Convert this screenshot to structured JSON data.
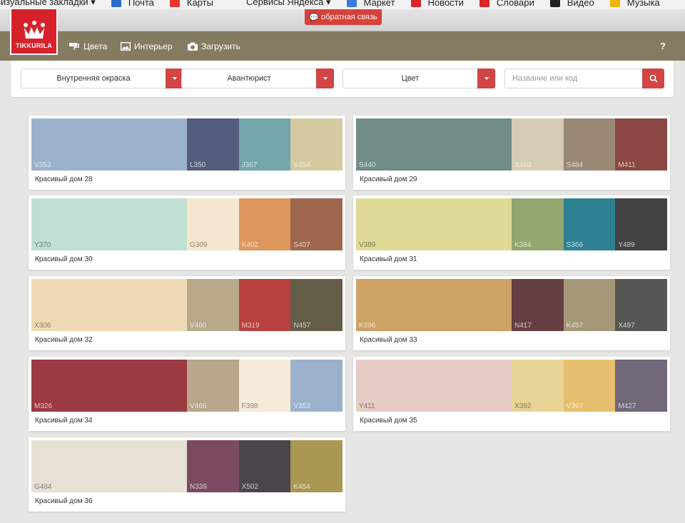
{
  "bookmarks": [
    {
      "label": "визуальные закладки ▾",
      "color": "#f2f2f2"
    },
    {
      "label": "Почта",
      "color": "#2a6ac9"
    },
    {
      "label": "Карты",
      "color": "#e8382e"
    },
    {
      "label": "Сервисы Яндекса ▾",
      "color": "#f2f2f2"
    },
    {
      "label": "Маркет",
      "color": "#3a7be0"
    },
    {
      "label": "Новости",
      "color": "#d9252a"
    },
    {
      "label": "Словари",
      "color": "#d9252a"
    },
    {
      "label": "Видео",
      "color": "#222222"
    },
    {
      "label": "Музыка",
      "color": "#f0b400"
    }
  ],
  "feedback_label": "обратная связь",
  "logo_text": "TIKKURILA",
  "nav": [
    {
      "label": "Цвета",
      "icon": "paint-roller-icon"
    },
    {
      "label": "Интерьер",
      "icon": "image-icon"
    },
    {
      "label": "Загрузить",
      "icon": "camera-icon"
    }
  ],
  "help_label": "?",
  "filters": {
    "type": "Внутренняя окраска",
    "collection": "Авантюрист",
    "color": "Цвет",
    "search_placeholder": "Название или код"
  },
  "palettes": [
    {
      "title": "Красивый дом 28",
      "swatches": [
        {
          "code": "V353",
          "hex": "#9cb2cc"
        },
        {
          "code": "L350",
          "hex": "#555d7f"
        },
        {
          "code": "J367",
          "hex": "#73a7aa"
        },
        {
          "code": "V454",
          "hex": "#d5c99f"
        }
      ]
    },
    {
      "title": "Красивый дом 29",
      "swatches": [
        {
          "code": "S440",
          "hex": "#728c87"
        },
        {
          "code": "X460",
          "hex": "#d6cbb4"
        },
        {
          "code": "S484",
          "hex": "#9a8876"
        },
        {
          "code": "M411",
          "hex": "#8c4844"
        }
      ]
    },
    {
      "title": "Красивый дом 30",
      "swatches": [
        {
          "code": "Y370",
          "hex": "#bfe0d3"
        },
        {
          "code": "G309",
          "hex": "#f5e6d0"
        },
        {
          "code": "K402",
          "hex": "#dd965c"
        },
        {
          "code": "S407",
          "hex": "#9e664c"
        }
      ]
    },
    {
      "title": "Красивый дом 31",
      "swatches": [
        {
          "code": "V389",
          "hex": "#e0da97"
        },
        {
          "code": "K384",
          "hex": "#95a56f"
        },
        {
          "code": "S366",
          "hex": "#2e8193"
        },
        {
          "code": "Y489",
          "hex": "#424243"
        }
      ]
    },
    {
      "title": "Красивый дом 32",
      "swatches": [
        {
          "code": "X306",
          "hex": "#efdab5"
        },
        {
          "code": "V460",
          "hex": "#b7a98a"
        },
        {
          "code": "M319",
          "hex": "#b84140"
        },
        {
          "code": "N457",
          "hex": "#645d48"
        }
      ]
    },
    {
      "title": "Красивый дом 33",
      "swatches": [
        {
          "code": "K396",
          "hex": "#cea165"
        },
        {
          "code": "N417",
          "hex": "#653e42"
        },
        {
          "code": "K457",
          "hex": "#a59879"
        },
        {
          "code": "X497",
          "hex": "#565653"
        }
      ]
    },
    {
      "title": "Красивый дом 34",
      "swatches": [
        {
          "code": "M326",
          "hex": "#9b3a42"
        },
        {
          "code": "V466",
          "hex": "#b8a68d"
        },
        {
          "code": "F398",
          "hex": "#f5ead8"
        },
        {
          "code": "V353",
          "hex": "#9cb2cc"
        }
      ]
    },
    {
      "title": "Красивый дом 35",
      "swatches": [
        {
          "code": "Y411",
          "hex": "#e8ccc6"
        },
        {
          "code": "X392",
          "hex": "#e8d495"
        },
        {
          "code": "V397",
          "hex": "#e6bf6e"
        },
        {
          "code": "M427",
          "hex": "#706779"
        }
      ]
    },
    {
      "title": "Красивый дом 36",
      "swatches": [
        {
          "code": "G484",
          "hex": "#e6e0d5"
        },
        {
          "code": "N339",
          "hex": "#7a4b60"
        },
        {
          "code": "X502",
          "hex": "#4a454b"
        },
        {
          "code": "K454",
          "hex": "#a99752"
        }
      ]
    }
  ]
}
